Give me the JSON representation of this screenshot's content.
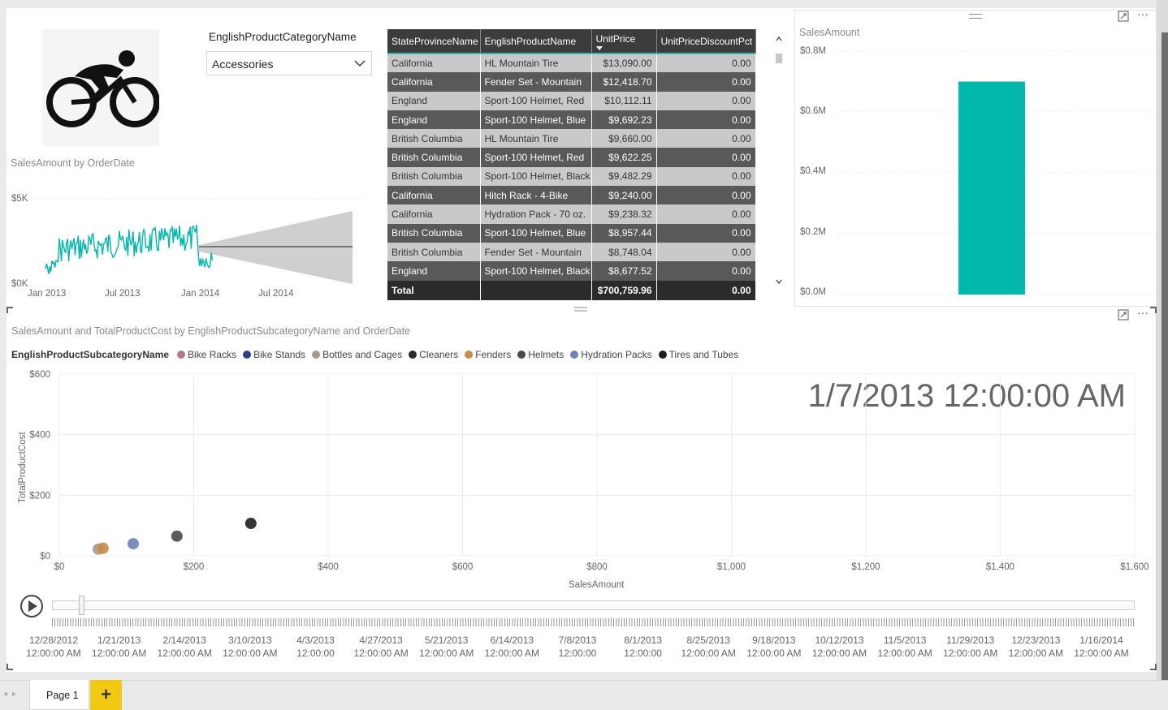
{
  "slicer": {
    "title": "EnglishProductCategoryName",
    "value": "Accessories"
  },
  "line_chart": {
    "title": "SalesAmount by OrderDate",
    "y_ticks": [
      "$5K",
      "$0K"
    ],
    "x_ticks": [
      "Jan 2013",
      "Jul 2013",
      "Jan 2014",
      "Jul 2014"
    ]
  },
  "table": {
    "columns": [
      "StateProvinceName",
      "EnglishProductName",
      "UnitPrice",
      "UnitPriceDiscountPct"
    ],
    "rows": [
      [
        "California",
        "HL Mountain Tire",
        "$13,090.00",
        "0.00"
      ],
      [
        "California",
        "Fender Set - Mountain",
        "$12,418.70",
        "0.00"
      ],
      [
        "England",
        "Sport-100 Helmet, Red",
        "$10,112.11",
        "0.00"
      ],
      [
        "England",
        "Sport-100 Helmet, Blue",
        "$9,692.23",
        "0.00"
      ],
      [
        "British Columbia",
        "HL Mountain Tire",
        "$9,660.00",
        "0.00"
      ],
      [
        "British Columbia",
        "Sport-100 Helmet, Red",
        "$9,622.25",
        "0.00"
      ],
      [
        "British Columbia",
        "Sport-100 Helmet, Black",
        "$9,482.29",
        "0.00"
      ],
      [
        "California",
        "Hitch Rack - 4-Bike",
        "$9,240.00",
        "0.00"
      ],
      [
        "California",
        "Hydration Pack - 70 oz.",
        "$9,238.32",
        "0.00"
      ],
      [
        "British Columbia",
        "Sport-100 Helmet, Blue",
        "$8,957.44",
        "0.00"
      ],
      [
        "British Columbia",
        "Fender Set - Mountain",
        "$8,748.04",
        "0.00"
      ],
      [
        "England",
        "Sport-100 Helmet, Black",
        "$8,677.52",
        "0.00"
      ]
    ],
    "total": {
      "label": "Total",
      "unit_price": "$700,759.96",
      "discount": "0.00"
    }
  },
  "column_chart": {
    "title": "SalesAmount",
    "y_ticks": [
      "$0.8M",
      "$0.6M",
      "$0.4M",
      "$0.2M",
      "$0.0M"
    ]
  },
  "scatter": {
    "title": "SalesAmount and TotalProductCost by EnglishProductSubcategoryName and OrderDate",
    "legend_title": "EnglishProductSubcategoryName",
    "legend": [
      {
        "name": "Bike Racks",
        "color": "#b57a8a"
      },
      {
        "name": "Bike Stands",
        "color": "#2e3f8f"
      },
      {
        "name": "Bottles and Cages",
        "color": "#a8998c"
      },
      {
        "name": "Cleaners",
        "color": "#2b2b2b"
      },
      {
        "name": "Fenders",
        "color": "#c88b48"
      },
      {
        "name": "Helmets",
        "color": "#4a4a4a"
      },
      {
        "name": "Hydration Packs",
        "color": "#6f81b8"
      },
      {
        "name": "Tires and Tubes",
        "color": "#1e1e1e"
      }
    ],
    "ylabel": "TotalProductCost",
    "xlabel": "SalesAmount",
    "y_ticks": [
      "$600",
      "$400",
      "$200",
      "$0"
    ],
    "x_ticks": [
      "$0",
      "$200",
      "$400",
      "$600",
      "$800",
      "$1,000",
      "$1,200",
      "$1,400",
      "$1,600"
    ],
    "current_frame": "1/7/2013 12:00:00 AM"
  },
  "play_axis": {
    "labels": [
      [
        "12/28/2012",
        "12:00:00 AM"
      ],
      [
        "1/21/2013",
        "12:00:00 AM"
      ],
      [
        "2/14/2013",
        "12:00:00 AM"
      ],
      [
        "3/10/2013",
        "12:00:00 AM"
      ],
      [
        "4/3/2013",
        "12:00:00"
      ],
      [
        "4/27/2013",
        "12:00:00 AM"
      ],
      [
        "5/21/2013",
        "12:00:00 AM"
      ],
      [
        "6/14/2013",
        "12:00:00 AM"
      ],
      [
        "7/8/2013",
        "12:00:00"
      ],
      [
        "8/1/2013",
        "12:00:00"
      ],
      [
        "8/25/2013",
        "12:00:00 AM"
      ],
      [
        "9/18/2013",
        "12:00:00 AM"
      ],
      [
        "10/12/2013",
        "12:00:00 AM"
      ],
      [
        "11/5/2013",
        "12:00:00 AM"
      ],
      [
        "11/29/2013",
        "12:00:00 AM"
      ],
      [
        "12/23/2013",
        "12:00:00 AM"
      ],
      [
        "1/16/2014",
        "12:00:00 AM"
      ]
    ],
    "position": 0.025
  },
  "tabs": {
    "page": "Page 1",
    "add": "+"
  },
  "chart_data": [
    {
      "type": "line",
      "title": "SalesAmount by OrderDate",
      "x_range": [
        "2012-12",
        "2014-09"
      ],
      "ylim": [
        0,
        5000
      ],
      "series": [
        {
          "values_summary": "daily SalesAmount Jan 2013 – Feb 2014, roughly 1,500–2,700 with forecast cone from Feb 2014 to Sep 2014 centered near 2,200"
        }
      ]
    },
    {
      "type": "bar",
      "title": "SalesAmount",
      "categories": [
        "Accessories"
      ],
      "values": [
        700000
      ],
      "ylim": [
        0,
        800000
      ],
      "color": "#01b8aa"
    },
    {
      "type": "scatter",
      "title": "SalesAmount and TotalProductCost by EnglishProductSubcategoryName and OrderDate",
      "xlabel": "SalesAmount",
      "ylabel": "TotalProductCost",
      "xlim": [
        0,
        1600
      ],
      "ylim": [
        0,
        600
      ],
      "points": [
        {
          "series": "Bottles and Cages",
          "x": 58,
          "y": 22
        },
        {
          "series": "Fenders",
          "x": 65,
          "y": 25
        },
        {
          "series": "Hydration Packs",
          "x": 110,
          "y": 40
        },
        {
          "series": "Helmets",
          "x": 175,
          "y": 65
        },
        {
          "series": "Tires and Tubes",
          "x": 285,
          "y": 107
        }
      ]
    }
  ]
}
